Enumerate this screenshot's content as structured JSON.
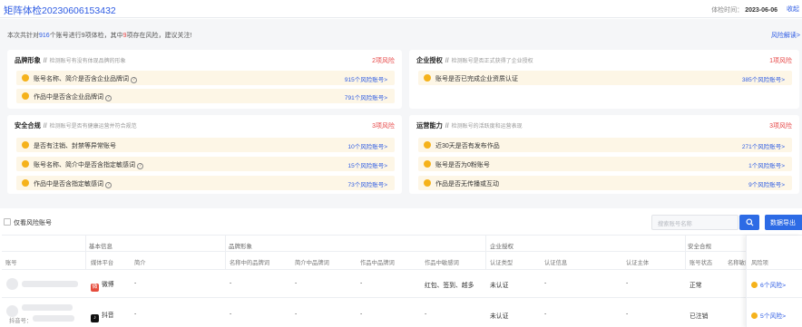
{
  "header": {
    "title": "矩阵体检20230606153432",
    "meta_label": "体检时间：",
    "meta_value": "2023-06-06",
    "collapse_label": "收起"
  },
  "summary": {
    "prefix": "本次共针对",
    "account_count": "916",
    "mid1": "个账号进行",
    "item_count": "9",
    "mid2": "项体检，其中",
    "risk_count": "9",
    "suffix": "项存在风险，建议关注!",
    "explain_link": "风险解读>"
  },
  "cards": [
    {
      "name": "品牌形象",
      "slash": "//",
      "desc": "检测账号有没有体现品牌的形象",
      "count": "2项风险",
      "rows": [
        {
          "text": "账号名称、简介是否含企业品牌词",
          "help": true,
          "link": "915个风险账号>"
        },
        {
          "text": "作品中是否含企业品牌词",
          "help": true,
          "link": "791个风险账号>"
        }
      ]
    },
    {
      "name": "企业授权",
      "slash": "//",
      "desc": "检测账号是否正式获得了企业授权",
      "count": "1项风险",
      "rows": [
        {
          "text": "账号是否已完成企业资质认证",
          "help": false,
          "link": "385个风险账号>"
        }
      ]
    },
    {
      "name": "安全合规",
      "slash": "//",
      "desc": "检测账号是否有健康运营并符合规范",
      "count": "3项风险",
      "rows": [
        {
          "text": "是否有注销、封禁等异常账号",
          "help": false,
          "link": "10个风险账号>"
        },
        {
          "text": "账号名称、简介中是否含指定敏感词",
          "help": true,
          "link": "15个风险账号>"
        },
        {
          "text": "作品中是否含指定敏感词",
          "help": true,
          "link": "73个风险账号>"
        }
      ]
    },
    {
      "name": "运营能力",
      "slash": "//",
      "desc": "检测账号的活跃度和运营表现",
      "count": "3项风险",
      "rows": [
        {
          "text": "近30天是否有发布作品",
          "help": false,
          "link": "271个风险账号>"
        },
        {
          "text": "账号是否为0粉账号",
          "help": false,
          "link": "1个风险账号>"
        },
        {
          "text": "作品是否无传播或互动",
          "help": false,
          "link": "9个风险账号>"
        }
      ]
    }
  ],
  "filter": {
    "checkbox_label": "仅看风险账号",
    "search_placeholder": "搜索账号名称",
    "export_label": "数据导出"
  },
  "table": {
    "groups": [
      "基本信息",
      "品牌形象",
      "企业授权",
      "安全合规"
    ],
    "columns": [
      "账号",
      "媒体平台",
      "简介",
      "名称中的品牌词",
      "简介中品牌词",
      "作品中品牌词",
      "作品中敏感词",
      "认证类型",
      "认证信息",
      "认证主体",
      "账号状态",
      "名称敏感",
      "风险项"
    ],
    "rows": [
      {
        "account": "",
        "platform": "微博",
        "platform_icon": "weibo-icon",
        "intro": "-",
        "name_brand": "-",
        "intro_brand": "-",
        "work_brand": "-",
        "work_sensitive": "红包、签到、越多",
        "auth_type": "未认证",
        "auth_info": "-",
        "auth_subject": "-",
        "status": "正常",
        "name_sensitive": "-",
        "risk": "6个风险>"
      },
      {
        "account": "抖音号：",
        "platform": "抖音",
        "platform_icon": "douyin-icon",
        "intro": "-",
        "name_brand": "-",
        "intro_brand": "-",
        "work_brand": "-",
        "work_sensitive": "-",
        "auth_type": "未认证",
        "auth_info": "-",
        "auth_subject": "-",
        "status": "已注销",
        "name_sensitive": "-",
        "risk": "5个风险>"
      }
    ]
  },
  "colors": {
    "accent": "#2d5be3",
    "risk_red": "#e64545",
    "warn_dot": "#f5b21b",
    "row_bg": "#fdf6e6",
    "button_blue": "#2d6be5"
  }
}
